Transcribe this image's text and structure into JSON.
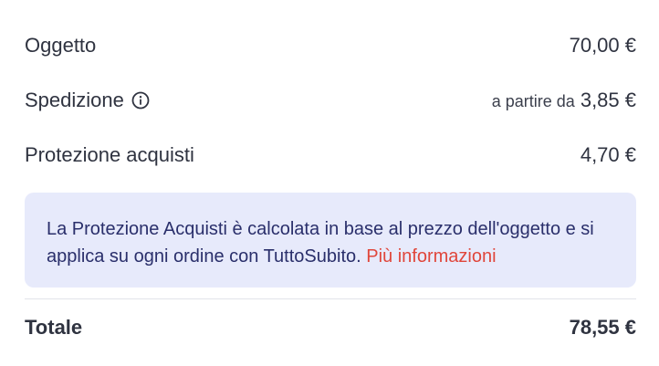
{
  "summary": {
    "item": {
      "label": "Oggetto",
      "value": "70,00 €"
    },
    "shipping": {
      "label": "Spedizione",
      "prefix": "a partire da",
      "value": "3,85 €",
      "icon": "info-icon"
    },
    "protection": {
      "label": "Protezione acquisti",
      "value": "4,70 €"
    }
  },
  "notice": {
    "text": "La Protezione Acquisti è calcolata in base al prezzo dell'oggetto e si applica su ogni ordine con TuttoSubito. ",
    "link": "Più informazioni"
  },
  "total": {
    "label": "Totale",
    "value": "78,55 €"
  },
  "colors": {
    "notice_bg": "#e7eafb",
    "notice_text": "#2a2f6b",
    "link": "#e0463b"
  }
}
